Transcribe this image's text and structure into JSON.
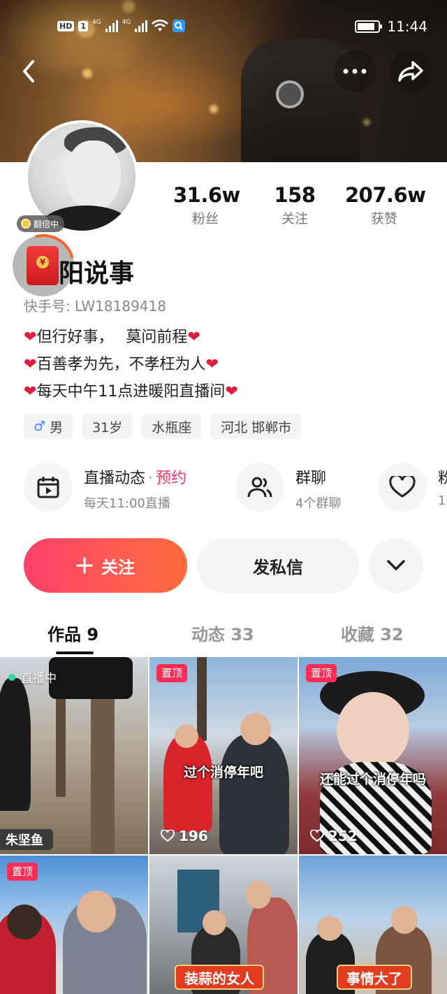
{
  "status_bar": {
    "hd": "HD",
    "sim1": "1",
    "net1": "4G",
    "net2": "4G",
    "time": "11:44"
  },
  "profile": {
    "avatar_badge": "翻倍中",
    "stats": [
      {
        "num": "31.6w",
        "label": "粉丝"
      },
      {
        "num": "158",
        "label": "关注"
      },
      {
        "num": "207.6w",
        "label": "获赞"
      }
    ],
    "nickname": "阳说事",
    "kuaishou_id": "快手号: LW18189418",
    "bio": [
      {
        "pre": "❤",
        "text": "但行好事，　 莫问前程",
        "post": "❤"
      },
      {
        "pre": "❤",
        "text": "百善孝为先，不孝枉为人",
        "post": "❤"
      },
      {
        "pre": "❤",
        "text": "每天中午11点进暖阳直播间",
        "post": "❤"
      }
    ],
    "tags": {
      "gender": "男",
      "age": "31岁",
      "zodiac": "水瓶座",
      "location": "河北 邯郸市"
    }
  },
  "features": {
    "live": {
      "title": "直播动态",
      "sep": "·",
      "reserve": "预约",
      "sub": "每天11:00直播"
    },
    "group": {
      "title": "群聊",
      "sub": "4个群聊"
    },
    "fans": {
      "title": "粉",
      "sub": "1"
    }
  },
  "actions": {
    "follow": "关注",
    "message": "发私信"
  },
  "tabs": [
    {
      "label": "作品 9",
      "active": true
    },
    {
      "label": "动态 33",
      "active": false
    },
    {
      "label": "收藏 32",
      "active": false
    }
  ],
  "videos": [
    {
      "badge": "",
      "live": "直播中",
      "likes": "",
      "caption": "",
      "banner": "朱坚鱼"
    },
    {
      "badge": "置顶",
      "live": "",
      "likes": "196",
      "caption": "过个消停年吧",
      "banner": ""
    },
    {
      "badge": "置顶",
      "live": "",
      "likes": "252",
      "caption": "还能过个消停年吗",
      "banner": ""
    },
    {
      "badge": "置顶",
      "live": "",
      "likes": "",
      "caption": "",
      "banner": ""
    },
    {
      "badge": "",
      "live": "",
      "likes": "",
      "caption": "",
      "banner": "装蒜的女人"
    },
    {
      "badge": "",
      "live": "",
      "likes": "",
      "caption": "",
      "banner": "事情大了"
    }
  ],
  "icons": [
    "back-icon",
    "more-icon",
    "share-icon",
    "calendar-play-icon",
    "group-icon",
    "heart-badge-icon",
    "plus-icon",
    "chevron-down-icon",
    "heart-outline-icon"
  ],
  "colors": {
    "accent": "#ff3b66",
    "follow_start": "#ff3f6c",
    "follow_end": "#ff6b3d",
    "heart": "#e21c3a",
    "sticky": "#ff2c55"
  }
}
